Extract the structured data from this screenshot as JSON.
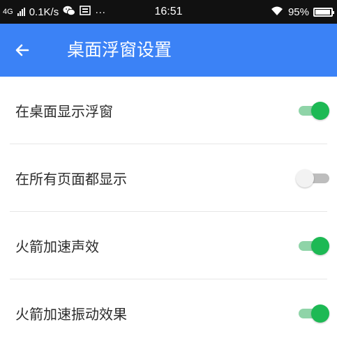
{
  "status_bar": {
    "network": "4G",
    "speed": "0.1K/s",
    "wechat_icon": "wechat-icon",
    "notification_icon": "notification-icon",
    "more": "···",
    "time": "16:51",
    "wifi_icon": "wifi-icon",
    "battery_text": "95%",
    "battery_level": 0.95
  },
  "app_bar": {
    "back_icon": "back-arrow-icon",
    "title": "桌面浮窗设置",
    "background": "#3b82f6"
  },
  "settings": [
    {
      "label": "在桌面显示浮窗",
      "enabled": true
    },
    {
      "label": "在所有页面都显示",
      "enabled": false
    },
    {
      "label": "火箭加速声效",
      "enabled": true
    },
    {
      "label": "火箭加速振动效果",
      "enabled": true
    }
  ],
  "colors": {
    "toggle_on": "#1db954",
    "toggle_off": "#bdbdbd"
  }
}
